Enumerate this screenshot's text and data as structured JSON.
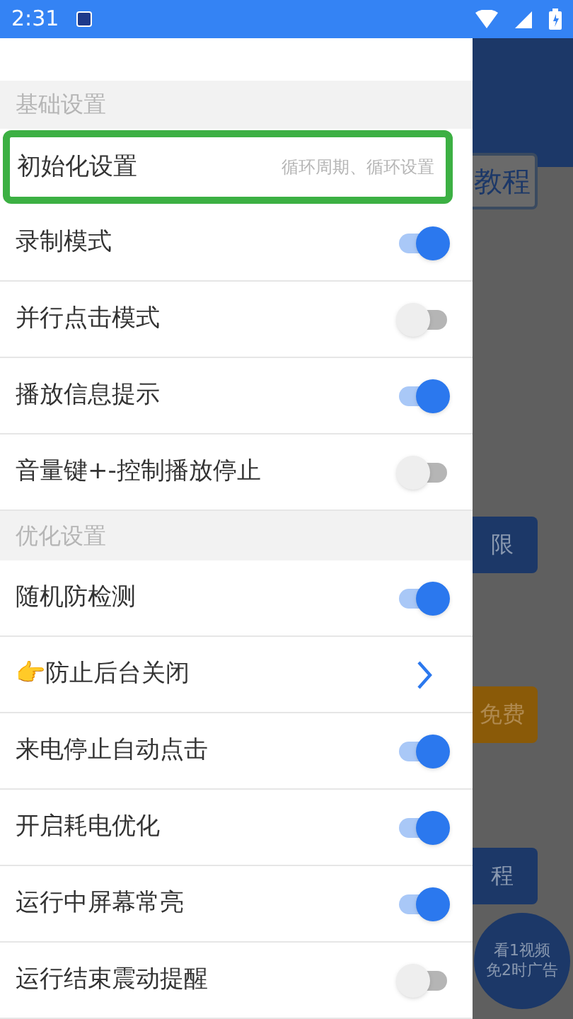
{
  "status_bar": {
    "time": "2:31"
  },
  "background_app": {
    "buttons": [
      {
        "label": "教程",
        "kind": "outline"
      },
      {
        "label": "限",
        "kind": "blue"
      },
      {
        "label": "免费",
        "kind": "orange"
      },
      {
        "label": "程",
        "kind": "blue"
      }
    ],
    "bubble": [
      "看1视频",
      "免2时广告"
    ]
  },
  "drawer": {
    "sections": [
      {
        "title": "基础设置",
        "items": [
          {
            "kind": "link",
            "label": "初始化设置",
            "detail": "循环周期、循环设置",
            "highlighted": true
          },
          {
            "kind": "toggle",
            "label": "录制模式",
            "on": true
          },
          {
            "kind": "toggle",
            "label": "并行点击模式",
            "on": false
          },
          {
            "kind": "toggle",
            "label": "播放信息提示",
            "on": true
          },
          {
            "kind": "toggle",
            "label": "音量键+-控制播放停止",
            "on": false
          }
        ]
      },
      {
        "title": "优化设置",
        "items": [
          {
            "kind": "toggle",
            "label": "随机防检测",
            "on": true
          },
          {
            "kind": "chevron",
            "label": "👉防止后台关闭"
          },
          {
            "kind": "toggle",
            "label": "来电停止自动点击",
            "on": true
          },
          {
            "kind": "toggle",
            "label": "开启耗电优化",
            "on": true
          },
          {
            "kind": "toggle",
            "label": "运行中屏幕常亮",
            "on": true
          },
          {
            "kind": "toggle",
            "label": "运行结束震动提醒",
            "on": false
          }
        ]
      }
    ]
  }
}
